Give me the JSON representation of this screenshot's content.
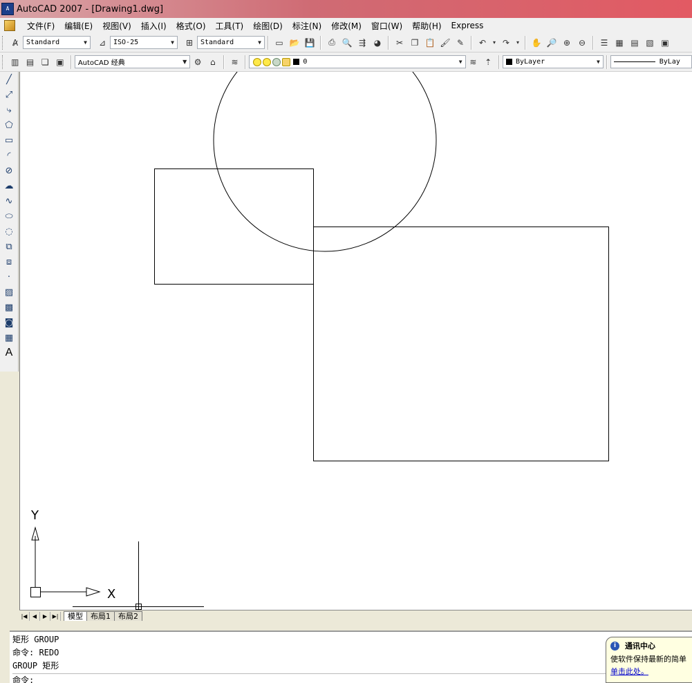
{
  "window": {
    "title": "AutoCAD 2007 - [Drawing1.dwg]",
    "logo_text": "A"
  },
  "menu": [
    "文件(F)",
    "编辑(E)",
    "视图(V)",
    "插入(I)",
    "格式(O)",
    "工具(T)",
    "绘图(D)",
    "标注(N)",
    "修改(M)",
    "窗口(W)",
    "帮助(H)",
    "Express"
  ],
  "toolbar1": {
    "text_style": "Standard",
    "dim_style": "ISO-25",
    "table_style": "Standard"
  },
  "toolbar2": {
    "workspace": "AutoCAD 经典",
    "layer": "0",
    "color": "ByLayer",
    "linetype": "ByLay"
  },
  "left_tools": [
    "line-icon",
    "construction-line-icon",
    "polyline-icon",
    "polygon-icon",
    "rectangle-icon",
    "arc-icon",
    "circle-icon",
    "revision-cloud-icon",
    "spline-icon",
    "ellipse-icon",
    "ellipse-arc-icon",
    "insert-block-icon",
    "make-block-icon",
    "point-icon",
    "hatch-icon",
    "gradient-icon",
    "region-icon",
    "table-icon"
  ],
  "left_text_tool": "A",
  "ucs": {
    "x_label": "X",
    "y_label": "Y"
  },
  "layout_tabs": [
    "模型",
    "布局1",
    "布局2"
  ],
  "command_history": [
    "矩形 GROUP",
    "命令: REDO",
    "GROUP 矩形"
  ],
  "command_prompt": "命令:",
  "comm_center": {
    "title": "通讯中心",
    "body": "使软件保持最新的简单",
    "link": "单击此处。"
  }
}
